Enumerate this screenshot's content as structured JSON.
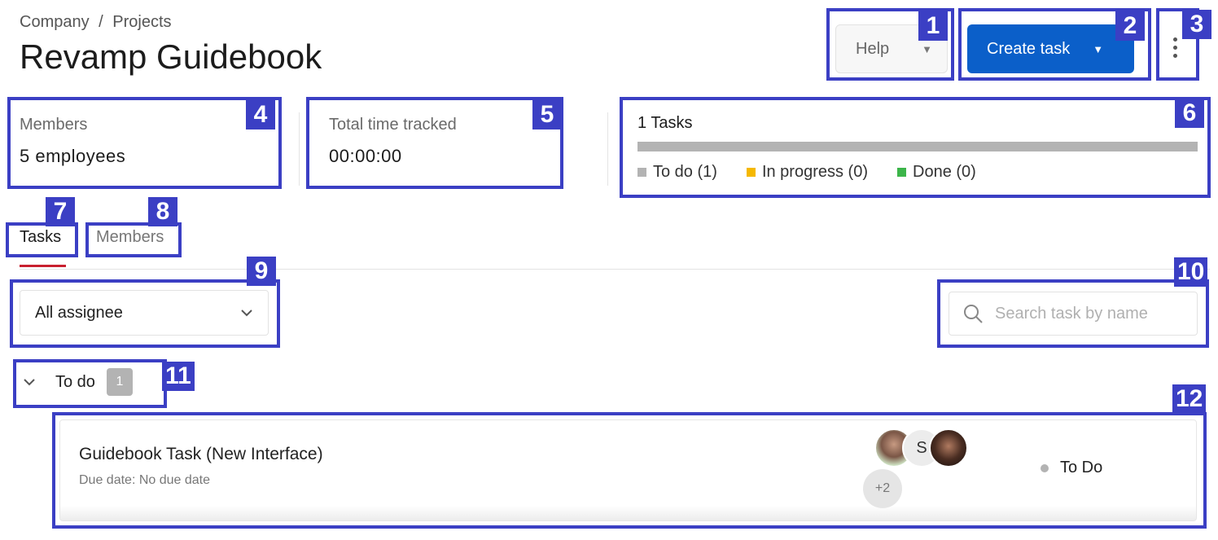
{
  "header": {
    "breadcrumb": [
      "Company",
      "/",
      "Projects"
    ],
    "title": "Revamp Guidebook"
  },
  "actions": {
    "help_label": "Help",
    "create_label": "Create task",
    "more_icon": "kebab-menu-icon"
  },
  "stats": {
    "members_label": "Members",
    "members_value": "5 employees",
    "time_label": "Total time tracked",
    "time_value": "00:00:00"
  },
  "tasks_summary": {
    "title": "1 Tasks",
    "legend": [
      {
        "label": "To do (1)",
        "color": "#b3b3b3"
      },
      {
        "label": "In progress (0)",
        "color": "#f5b800"
      },
      {
        "label": "Done (0)",
        "color": "#3cb54a"
      }
    ]
  },
  "tabs": [
    {
      "label": "Tasks",
      "active": true
    },
    {
      "label": "Members",
      "active": false
    }
  ],
  "filters": {
    "assignee_value": "All assignee",
    "search_placeholder": "Search task by name"
  },
  "group": {
    "label": "To do",
    "count": "1"
  },
  "task": {
    "title": "Guidebook Task (New Interface)",
    "due": "Due date: No due date",
    "avatar_alt_text": "S",
    "more_assignees": "+2",
    "status": "To Do"
  },
  "annotations": [
    "1",
    "2",
    "3",
    "4",
    "5",
    "6",
    "7",
    "8",
    "9",
    "10",
    "11",
    "12"
  ],
  "colors": {
    "primary": "#0b5fc9",
    "tab_accent": "#c8202f",
    "annotation": "#3b3fc4"
  }
}
